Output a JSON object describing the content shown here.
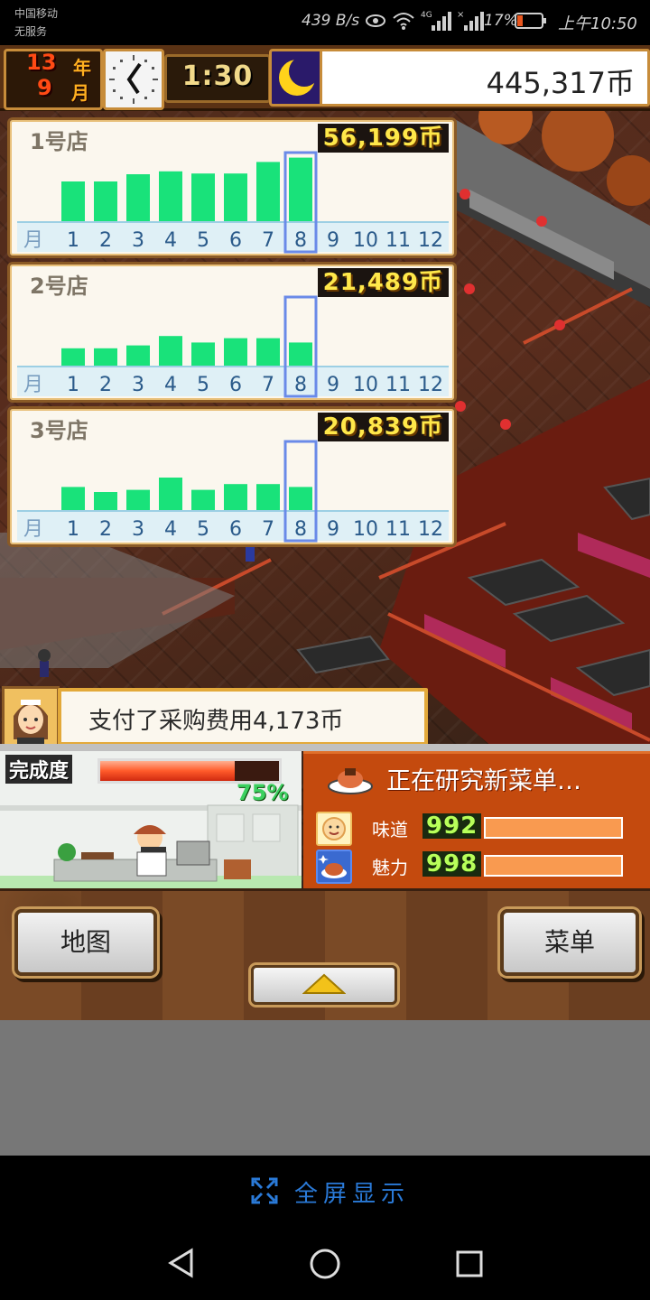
{
  "status_bar": {
    "carrier_line1": "中国移动",
    "carrier_line2": "无服务",
    "net_speed": "439 B/s",
    "signal_label": "4G",
    "battery_percent": "17%",
    "time": "上午10:50"
  },
  "hud": {
    "year_num": "13",
    "year_unit": "年",
    "month_num": "9",
    "month_unit": "月",
    "time": "1:30",
    "money": "445,317币"
  },
  "stores": [
    {
      "name": "1号店",
      "total": "56,199币",
      "month_label": "月",
      "months": [
        "1",
        "2",
        "3",
        "4",
        "5",
        "6",
        "7",
        "8",
        "9",
        "10",
        "11",
        "12"
      ],
      "bar_values": [
        0.55,
        0.55,
        0.65,
        0.69,
        0.66,
        0.66,
        0.82,
        0.88
      ],
      "selected_month": 8
    },
    {
      "name": "2号店",
      "total": "21,489币",
      "month_label": "月",
      "months": [
        "1",
        "2",
        "3",
        "4",
        "5",
        "6",
        "7",
        "8",
        "9",
        "10",
        "11",
        "12"
      ],
      "bar_values": [
        0.24,
        0.24,
        0.28,
        0.41,
        0.32,
        0.38,
        0.38,
        0.32
      ],
      "selected_month": 8
    },
    {
      "name": "3号店",
      "total": "20,839币",
      "month_label": "月",
      "months": [
        "1",
        "2",
        "3",
        "4",
        "5",
        "6",
        "7",
        "8",
        "9",
        "10",
        "11",
        "12"
      ],
      "bar_values": [
        0.32,
        0.25,
        0.28,
        0.45,
        0.28,
        0.36,
        0.36,
        0.32
      ],
      "selected_month": 8
    }
  ],
  "message": {
    "text": "支付了采购费用4,173币"
  },
  "progress": {
    "label": "完成度",
    "percent_text": "75%",
    "value": 0.75
  },
  "research": {
    "title": "正在研究新菜单…",
    "taste_label": "味道",
    "taste_value": "992",
    "charm_label": "魅力",
    "charm_value": "998"
  },
  "controls": {
    "map_label": "地图",
    "menu_label": "菜单"
  },
  "fullscreen": {
    "label": "全屏显示"
  },
  "colors": {
    "bar_green": "#19e27a",
    "selected_outline": "#6a8ae8",
    "accent_orange": "#c44a0e"
  }
}
